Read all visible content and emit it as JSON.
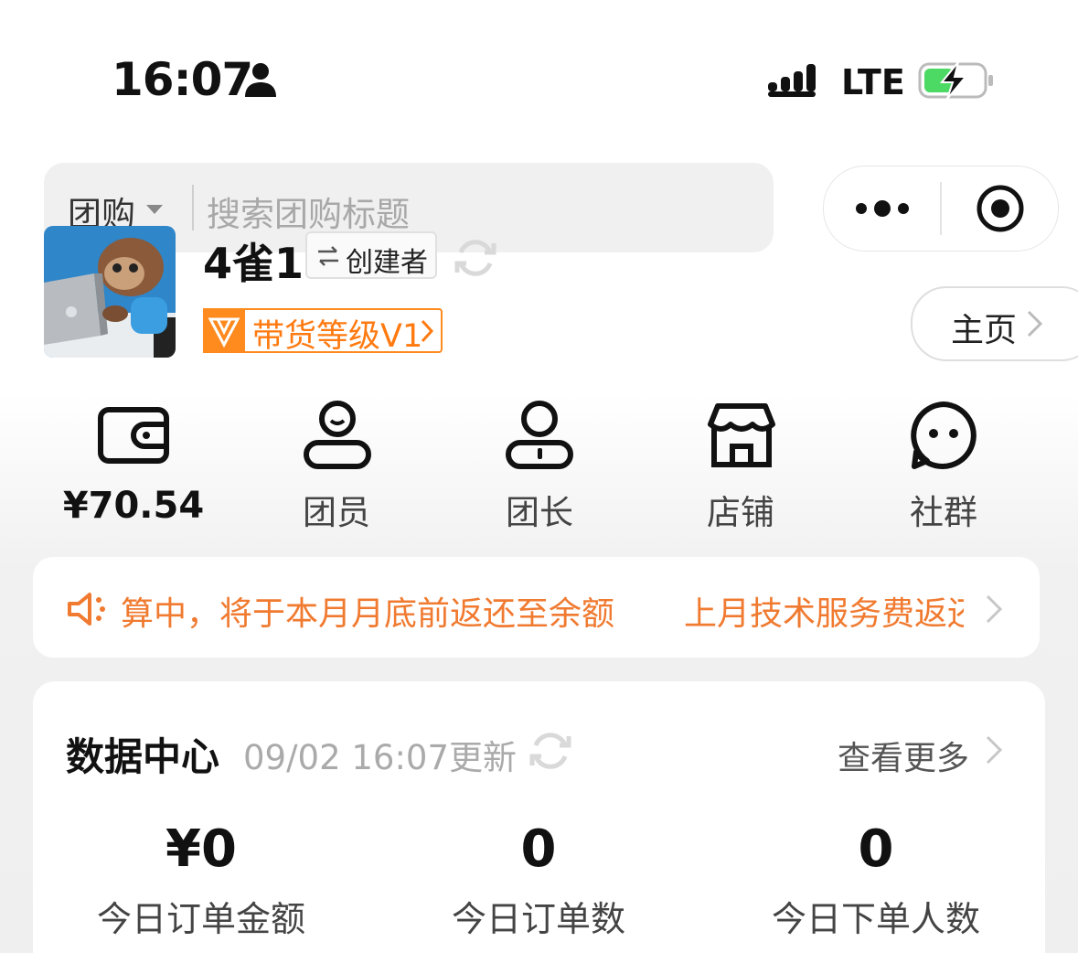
{
  "status_bar": {
    "time": "16:07",
    "network": "LTE",
    "icons": [
      "person-icon",
      "signal-icon",
      "battery-charging-icon"
    ]
  },
  "search": {
    "scope": "团购",
    "placeholder": "搜索团购标题"
  },
  "profile": {
    "name": "4雀1",
    "role": "创建者",
    "level": "带货等级V1",
    "home_button": "主页"
  },
  "quick_actions": [
    {
      "label": "¥70.54",
      "icon": "wallet-icon"
    },
    {
      "label": "团员",
      "icon": "member-icon"
    },
    {
      "label": "团长",
      "icon": "leader-icon"
    },
    {
      "label": "店铺",
      "icon": "store-icon"
    },
    {
      "label": "社群",
      "icon": "chat-icon"
    }
  ],
  "notice": {
    "text_1": "算中，将于本月月底前返还至余额",
    "text_2": "上月技术服务费返还"
  },
  "data_center": {
    "title": "数据中心",
    "updated": "09/02 16:07更新",
    "view_more": "查看更多",
    "stats": [
      {
        "value": "¥0",
        "label": "今日订单金额"
      },
      {
        "value": "0",
        "label": "今日订单数"
      },
      {
        "value": "0",
        "label": "今日下单人数"
      }
    ]
  },
  "colors": {
    "accent_orange": "#ff8a1e",
    "notice_orange": "#f07a30",
    "battery_green": "#4cd964"
  }
}
